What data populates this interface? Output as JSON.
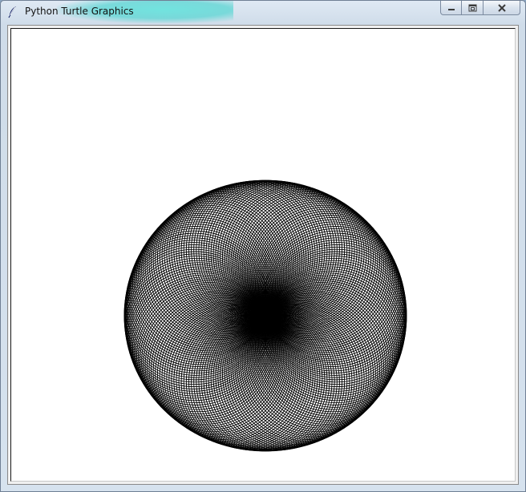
{
  "window": {
    "title": "Python Turtle Graphics",
    "icon": "feather-icon"
  },
  "controls": [
    {
      "name": "minimize",
      "icon": "minimize-icon"
    },
    {
      "name": "maximize",
      "icon": "maximize-icon"
    },
    {
      "name": "close",
      "icon": "close-icon"
    }
  ],
  "drawing": {
    "shape": "torus-spirograph",
    "pen_color": "#000000",
    "background": "#ffffff"
  }
}
